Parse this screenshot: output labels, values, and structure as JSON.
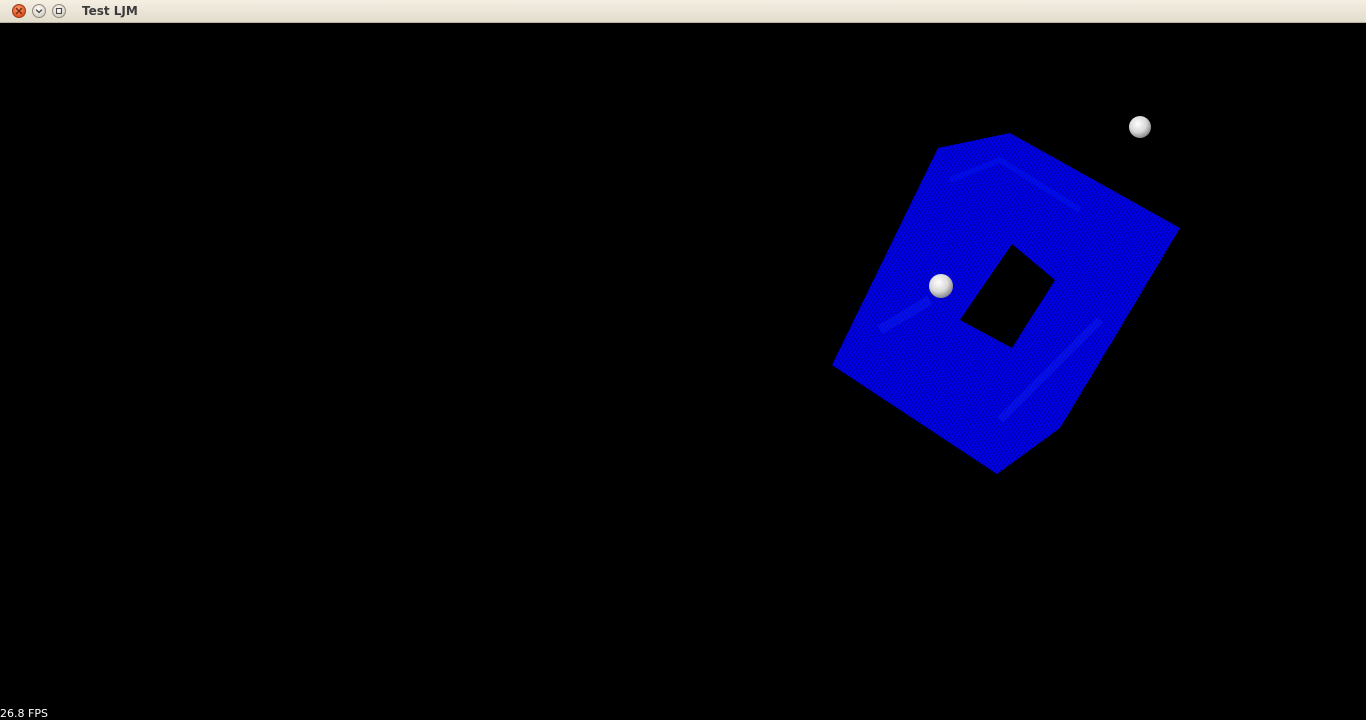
{
  "window": {
    "title": "Test LJM",
    "buttons": {
      "close": "close-icon",
      "minimize": "chevron-down-icon",
      "maximize": "maximize-icon"
    }
  },
  "viewport": {
    "background": "#000000",
    "mesh_color": "#0000ff",
    "sphere_color": "#e6e6e6"
  },
  "overlay": {
    "fps_text": "26.8 FPS"
  }
}
